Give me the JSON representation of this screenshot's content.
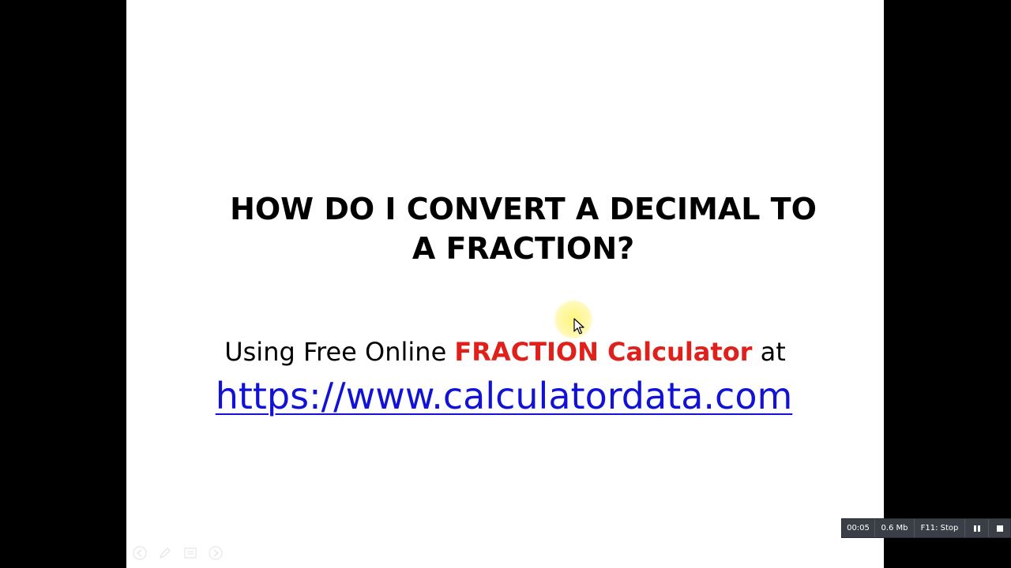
{
  "slide": {
    "title_line1": "HOW DO I CONVERT A DECIMAL TO",
    "title_line2": "A FRACTION?",
    "subtitle_prefix": "Using Free Online ",
    "subtitle_highlight": "FRACTION Calculator",
    "subtitle_suffix": " at",
    "link_text": "https://www.calculatordata.com"
  },
  "recorder": {
    "elapsed": "00:05",
    "file_size": "0.6 Mb",
    "stop_label": "F11: Stop",
    "pause_icon": "pause-icon",
    "stop_icon": "stop-square-icon"
  },
  "nav_controls": {
    "icons": [
      "arrow-left-icon",
      "pen-icon",
      "menu-icon",
      "arrow-right-icon"
    ]
  },
  "colors": {
    "highlight": "#e0201b",
    "link": "#1212d6",
    "recorder_bg": "#3a3f47"
  }
}
